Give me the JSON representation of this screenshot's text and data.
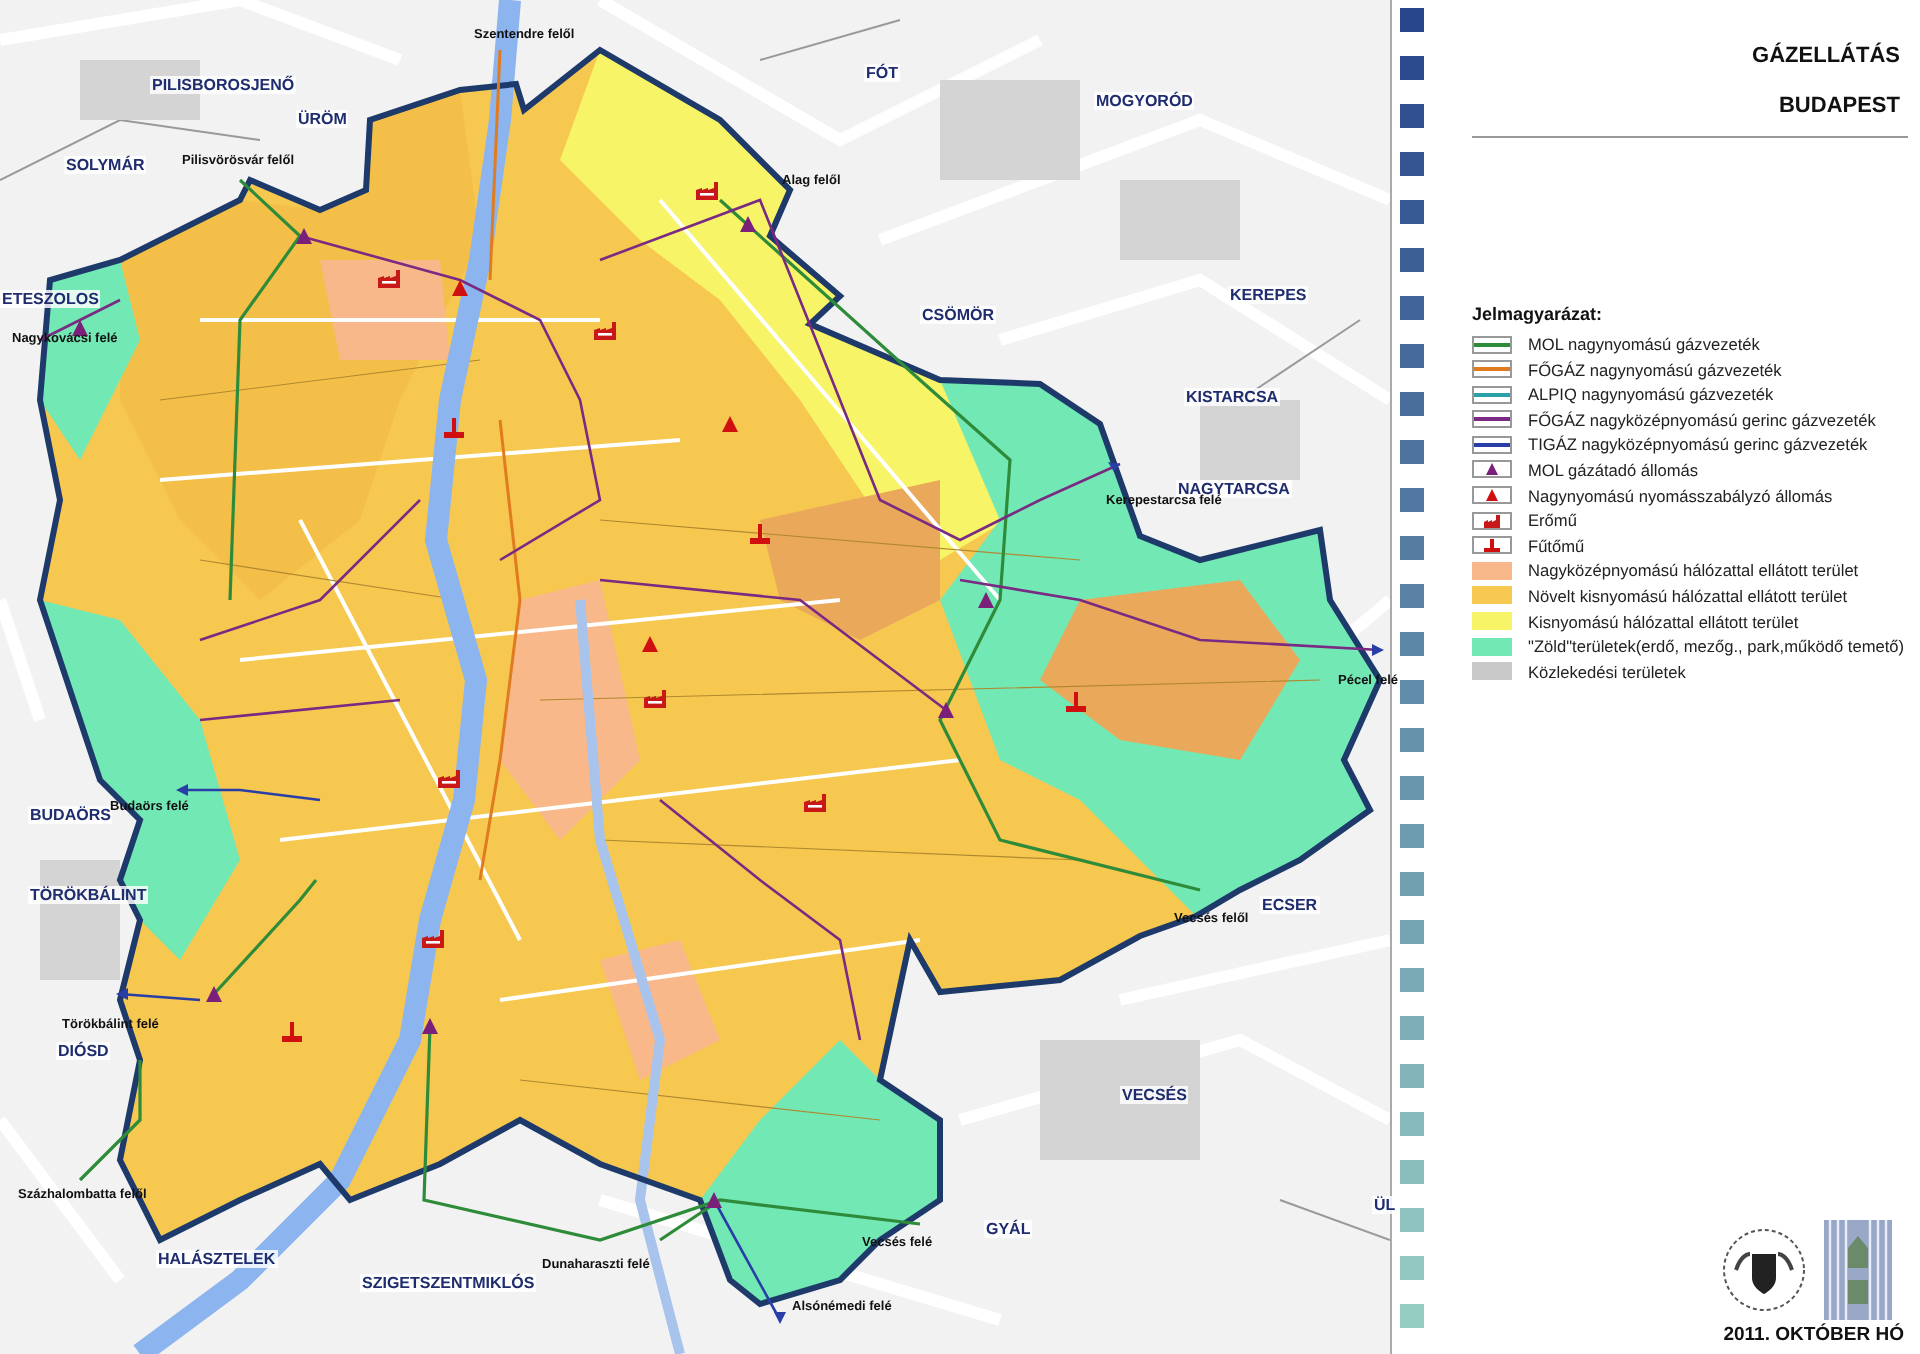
{
  "map": {
    "labels": [
      {
        "kind": "direction",
        "text": "Szentendre felől"
      },
      {
        "kind": "place",
        "text": "PILISBOROSJENŐ"
      },
      {
        "kind": "place",
        "text": "ÜRÖM"
      },
      {
        "kind": "place",
        "text": "FÓT"
      },
      {
        "kind": "place",
        "text": "MOGYORÓD"
      },
      {
        "kind": "place",
        "text": "SOLYMÁR"
      },
      {
        "kind": "direction",
        "text": "Pilisvörösvár felől"
      },
      {
        "kind": "direction",
        "text": "Alag felől"
      },
      {
        "kind": "place",
        "text": "ETESZOLOS"
      },
      {
        "kind": "place",
        "text": "CSÖMÖR"
      },
      {
        "kind": "place",
        "text": "KEREPES"
      },
      {
        "kind": "direction",
        "text": "Nagykovácsi felé"
      },
      {
        "kind": "place",
        "text": "KISTARCSA"
      },
      {
        "kind": "place",
        "text": "NAGYTARCSA"
      },
      {
        "kind": "direction",
        "text": "Kerepestarcsa felé"
      },
      {
        "kind": "direction",
        "text": "Pécel felé"
      },
      {
        "kind": "place",
        "text": "BUDAÖRS"
      },
      {
        "kind": "direction",
        "text": "Budaörs felé"
      },
      {
        "kind": "place",
        "text": "TÖRÖKBÁLINT"
      },
      {
        "kind": "place",
        "text": "ECSER"
      },
      {
        "kind": "direction",
        "text": "Vecsés felől"
      },
      {
        "kind": "direction",
        "text": "Törökbálint felé"
      },
      {
        "kind": "place",
        "text": "DIÓSD"
      },
      {
        "kind": "place",
        "text": "VECSÉS"
      },
      {
        "kind": "direction",
        "text": "Százhalombatta felől"
      },
      {
        "kind": "place",
        "text": "HALÁSZTELEK"
      },
      {
        "kind": "direction",
        "text": "Vecsés felé"
      },
      {
        "kind": "place",
        "text": "GYÁL"
      },
      {
        "kind": "place",
        "text": "ÜL"
      },
      {
        "kind": "place",
        "text": "SZIGETSZENTMIKLÓS"
      },
      {
        "kind": "direction",
        "text": "Dunaharaszti felé"
      },
      {
        "kind": "direction",
        "text": "Alsónémedi felé"
      }
    ]
  },
  "title": {
    "main": "GÁZELLÁTÁS",
    "sub": "BUDAPEST"
  },
  "legend": {
    "heading": "Jelmagyarázat:",
    "items": [
      {
        "kind": "line",
        "color": "#2e8b3a",
        "label": "MOL nagynyomású gázvezeték"
      },
      {
        "kind": "line",
        "color": "#e07b20",
        "label": "FŐGÁZ nagynyomású gázvezeték"
      },
      {
        "kind": "line",
        "color": "#2aa0a8",
        "label": "ALPIQ nagynyomású gázvezeték"
      },
      {
        "kind": "line",
        "color": "#7a2a82",
        "label": "FŐGÁZ nagyközépnyomású gerinc gázvezeték"
      },
      {
        "kind": "line",
        "color": "#2a3ea8",
        "label": "TIGÁZ nagyközépnyomású gerinc gázvezeték"
      },
      {
        "kind": "triangle",
        "color": "#7a1f7a",
        "label": "MOL gázátadó állomás"
      },
      {
        "kind": "triangle",
        "color": "#d01010",
        "label": "Nagynyomású nyomásszabályzó állomás"
      },
      {
        "kind": "factory",
        "color": "#c81818",
        "label": "Erőmű"
      },
      {
        "kind": "chimney",
        "color": "#d01010",
        "label": "Fűtőmű"
      },
      {
        "kind": "area",
        "color": "#f8b88a",
        "label": "Nagyközépnyomású hálózattal ellátott terület"
      },
      {
        "kind": "area",
        "color": "#f6c850",
        "label": "Növelt kisnyomású hálózattal ellátott terület"
      },
      {
        "kind": "area",
        "color": "#f8f468",
        "label": "Kisnyomású hálózattal ellátott terület"
      },
      {
        "kind": "area",
        "color": "#72e8b4",
        "label": "\"Zöld\"területek(erdő, mezőg., park,működő temető)"
      },
      {
        "kind": "area",
        "color": "#c8c8c8",
        "label": "Közlekedési területek"
      }
    ]
  },
  "date": "2011. OKTÓBER HÓ"
}
